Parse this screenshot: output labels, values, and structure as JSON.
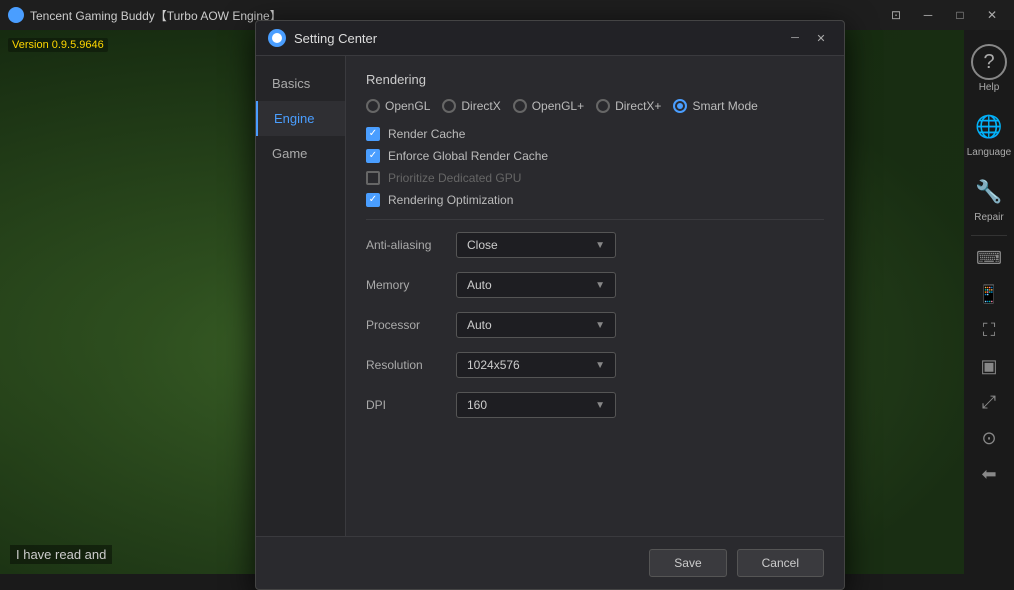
{
  "titleBar": {
    "appTitle": "Tencent Gaming Buddy【Turbo AOW Engine】",
    "controls": {
      "restore": "⊡",
      "minimize": "─",
      "maximize": "□",
      "close": "✕"
    }
  },
  "version": "Version 0.9.5.9646",
  "dialog": {
    "title": "Setting Center",
    "controls": {
      "minimize": "─",
      "close": "✕"
    },
    "nav": {
      "items": [
        {
          "label": "Basics",
          "active": false
        },
        {
          "label": "Engine",
          "active": true
        },
        {
          "label": "Game",
          "active": false
        }
      ]
    },
    "content": {
      "sectionTitle": "Rendering",
      "renderModes": [
        {
          "label": "OpenGL",
          "checked": false
        },
        {
          "label": "DirectX",
          "checked": false
        },
        {
          "label": "OpenGL+",
          "checked": false
        },
        {
          "label": "DirectX+",
          "checked": false
        },
        {
          "label": "Smart Mode",
          "checked": true
        }
      ],
      "checkboxes": [
        {
          "label": "Render Cache",
          "checked": true,
          "disabled": false
        },
        {
          "label": "Enforce Global Render Cache",
          "checked": true,
          "disabled": false
        },
        {
          "label": "Prioritize Dedicated GPU",
          "checked": false,
          "disabled": true
        },
        {
          "label": "Rendering Optimization",
          "checked": true,
          "disabled": false
        }
      ],
      "settings": [
        {
          "label": "Anti-aliasing",
          "value": "Close"
        },
        {
          "label": "Memory",
          "value": "Auto"
        },
        {
          "label": "Processor",
          "value": "Auto"
        },
        {
          "label": "Resolution",
          "value": "1024x576"
        },
        {
          "label": "DPI",
          "value": "160"
        }
      ]
    },
    "footer": {
      "saveLabel": "Save",
      "cancelLabel": "Cancel"
    }
  },
  "rightSidebar": {
    "items": [
      {
        "icon": "?",
        "label": "Help"
      },
      {
        "icon": "🌐",
        "label": "Language"
      },
      {
        "icon": "🔧",
        "label": "Repair"
      }
    ]
  },
  "bottomText": "I have read and"
}
